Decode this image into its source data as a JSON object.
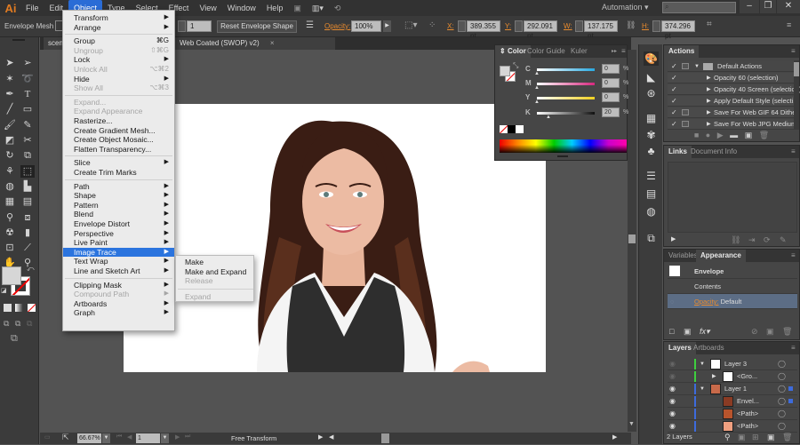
{
  "app": {
    "logo": "Ai"
  },
  "menubar": {
    "items": [
      "File",
      "Edit",
      "Object",
      "Type",
      "Select",
      "Effect",
      "View",
      "Window",
      "Help"
    ],
    "active": "Object",
    "workspace": "Automation",
    "search_placeholder": "",
    "window_buttons": [
      "–",
      "❐",
      "✕"
    ]
  },
  "control_bar": {
    "mode_label": "Envelope Mesh",
    "rows_value": "1",
    "reset_button": "Reset Envelope Shape",
    "opacity_label": "Opacity:",
    "opacity_value": "100%",
    "x_label": "X:",
    "x_value": "389.355 pt",
    "y_label": "Y:",
    "y_value": "292.091 pt",
    "w_label": "W:",
    "w_value": "137.175 pt",
    "h_label": "H:",
    "h_value": "374.296 pt"
  },
  "document": {
    "tab_prefix": "scene",
    "tab_title": "Web Coated (SWOP) v2)",
    "tab_close": "×"
  },
  "object_menu": {
    "items": [
      {
        "label": "Transform",
        "submenu": true,
        "disabled": false
      },
      {
        "label": "Arrange",
        "submenu": true,
        "disabled": false
      },
      {
        "separator": true
      },
      {
        "label": "Group",
        "shortcut": "⌘G",
        "disabled": false
      },
      {
        "label": "Ungroup",
        "shortcut": "⇧⌘G",
        "disabled": true
      },
      {
        "label": "Lock",
        "submenu": true,
        "disabled": false
      },
      {
        "label": "Unlock All",
        "shortcut": "⌥⌘2",
        "disabled": true
      },
      {
        "label": "Hide",
        "submenu": true,
        "disabled": false
      },
      {
        "label": "Show All",
        "shortcut": "⌥⌘3",
        "disabled": true
      },
      {
        "separator": true
      },
      {
        "label": "Expand...",
        "disabled": true
      },
      {
        "label": "Expand Appearance",
        "disabled": true
      },
      {
        "label": "Rasterize...",
        "disabled": false
      },
      {
        "label": "Create Gradient Mesh...",
        "disabled": false
      },
      {
        "label": "Create Object Mosaic...",
        "disabled": false
      },
      {
        "label": "Flatten Transparency...",
        "disabled": false
      },
      {
        "separator": true
      },
      {
        "label": "Slice",
        "submenu": true,
        "disabled": false
      },
      {
        "label": "Create Trim Marks",
        "disabled": false
      },
      {
        "separator": true
      },
      {
        "label": "Path",
        "submenu": true,
        "disabled": false
      },
      {
        "label": "Shape",
        "submenu": true,
        "disabled": false
      },
      {
        "label": "Pattern",
        "submenu": true,
        "disabled": false
      },
      {
        "label": "Blend",
        "submenu": true,
        "disabled": false
      },
      {
        "label": "Envelope Distort",
        "submenu": true,
        "disabled": false
      },
      {
        "label": "Perspective",
        "submenu": true,
        "disabled": false
      },
      {
        "label": "Live Paint",
        "submenu": true,
        "disabled": false
      },
      {
        "label": "Image Trace",
        "submenu": true,
        "disabled": false,
        "highlighted": true
      },
      {
        "label": "Text Wrap",
        "submenu": true,
        "disabled": false
      },
      {
        "label": "Line and Sketch Art",
        "submenu": true,
        "disabled": false
      },
      {
        "separator": true
      },
      {
        "label": "Clipping Mask",
        "submenu": true,
        "disabled": false
      },
      {
        "label": "Compound Path",
        "submenu": true,
        "disabled": true
      },
      {
        "label": "Artboards",
        "submenu": true,
        "disabled": false
      },
      {
        "label": "Graph",
        "submenu": true,
        "disabled": false
      }
    ]
  },
  "image_trace_submenu": {
    "items": [
      {
        "label": "Make",
        "disabled": false
      },
      {
        "label": "Make and Expand",
        "disabled": false
      },
      {
        "label": "Release",
        "disabled": true
      },
      {
        "separator": true
      },
      {
        "label": "Expand",
        "disabled": true
      }
    ]
  },
  "color_panel": {
    "tabs": [
      "Color",
      "Color Guide",
      "Kuler"
    ],
    "active_tab": "Color",
    "sliders": [
      {
        "label": "C",
        "value": "0",
        "unit": "%",
        "fraction": 0.0
      },
      {
        "label": "M",
        "value": "0",
        "unit": "%",
        "fraction": 0.0
      },
      {
        "label": "Y",
        "value": "0",
        "unit": "%",
        "fraction": 0.0
      },
      {
        "label": "K",
        "value": "20",
        "unit": "%",
        "fraction": 0.2
      }
    ],
    "fill_color": "#cccccc",
    "accent_colors": {
      "cyan": "#2aa9e0",
      "magenta": "#d6287e",
      "yellow": "#f0d020",
      "black": "#111111"
    }
  },
  "actions_panel": {
    "title": "Actions",
    "rows": [
      {
        "check": "✓",
        "dialog": true,
        "expand": "▼",
        "folder": true,
        "label": "Default Actions"
      },
      {
        "check": "✓",
        "dialog": false,
        "expand": "▶",
        "label": "Opacity 60 (selection)"
      },
      {
        "check": "✓",
        "dialog": false,
        "expand": "▶",
        "label": "Opacity 40 Screen (selection)"
      },
      {
        "check": "✓",
        "dialog": false,
        "expand": "▶",
        "label": "Apply Default Style (selecti..."
      },
      {
        "check": "✓",
        "dialog": true,
        "expand": "▶",
        "label": "Save For Web GIF 64 Dithe..."
      },
      {
        "check": "✓",
        "dialog": true,
        "expand": "▶",
        "label": "Save For Web JPG Medium"
      }
    ]
  },
  "links_panel": {
    "tabs": [
      "Links",
      "Document Info"
    ],
    "active_tab": "Links"
  },
  "appearance_panel": {
    "tabs": [
      "Variables",
      "Appearance"
    ],
    "active_tab": "Appearance",
    "object": "Envelope",
    "contents": "Contents",
    "opacity_label": "Opacity:",
    "opacity_value": "Default"
  },
  "layers_panel": {
    "tabs": [
      "Layers",
      "Artboards"
    ],
    "active_tab": "Layers",
    "rows": [
      {
        "name": "Layer 3",
        "expand": "▼",
        "color": "#3ecf3e",
        "visible": false,
        "indent": 0
      },
      {
        "name": "<Gro...",
        "expand": "▶",
        "color": "#3ecf3e",
        "visible": false,
        "indent": 1
      },
      {
        "name": "Layer 1",
        "expand": "▼",
        "color": "#3d6bdc",
        "visible": true,
        "indent": 0
      },
      {
        "name": "Envel...",
        "expand": "",
        "color": "#3d6bdc",
        "visible": true,
        "indent": 1
      },
      {
        "name": "<Path>",
        "expand": "",
        "color": "#3d6bdc",
        "visible": true,
        "indent": 1
      },
      {
        "name": "<Path>",
        "expand": "",
        "color": "#3d6bdc",
        "visible": true,
        "indent": 1
      }
    ],
    "footer": "2 Layers"
  },
  "status_bar": {
    "zoom": "66.67%",
    "artboard": "1",
    "tool": "Free Transform"
  }
}
